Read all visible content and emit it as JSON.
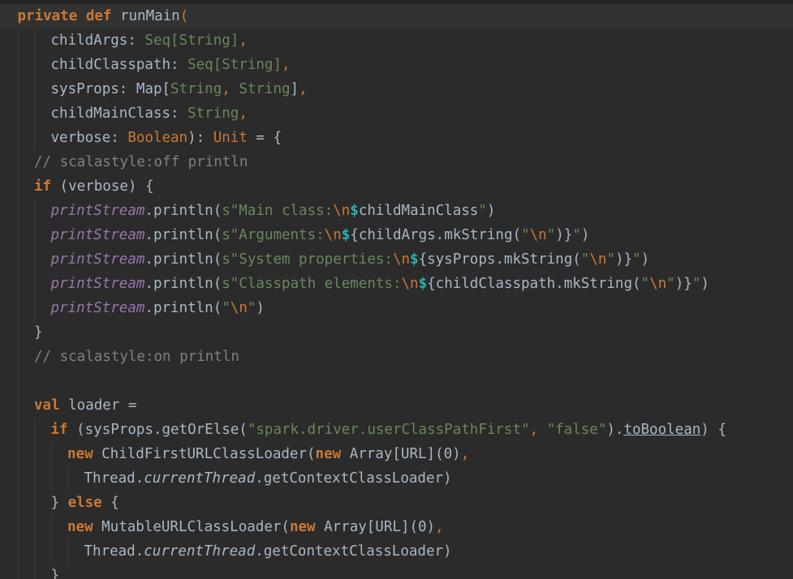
{
  "editor": {
    "colors": {
      "background": "#2b2b2b",
      "caret_row": "#323232",
      "keyword": "#cc7832",
      "string": "#6a8759",
      "comment": "#808080",
      "field": "#9876aa",
      "default": "#a9b7c6",
      "interpolation": "#27b3b3"
    },
    "lines": [
      {
        "indent": 1,
        "guides": [],
        "tokens": [
          {
            "t": "private",
            "c": "kw"
          },
          {
            "t": " ",
            "c": "pl"
          },
          {
            "t": "def",
            "c": "kw"
          },
          {
            "t": " runMain",
            "c": "pl"
          },
          {
            "t": "(",
            "c": "kwn"
          }
        ]
      },
      {
        "indent": 3,
        "guides": [
          1,
          2
        ],
        "tokens": [
          {
            "t": "childArgs",
            "c": "pl"
          },
          {
            "t": ": ",
            "c": "pl"
          },
          {
            "t": "Seq[String]",
            "c": "ty"
          },
          {
            "t": ",",
            "c": "kwn"
          }
        ]
      },
      {
        "indent": 3,
        "guides": [
          1,
          2
        ],
        "tokens": [
          {
            "t": "childClasspath",
            "c": "pl"
          },
          {
            "t": ": ",
            "c": "pl"
          },
          {
            "t": "Seq[String]",
            "c": "ty"
          },
          {
            "t": ",",
            "c": "kwn"
          }
        ]
      },
      {
        "indent": 3,
        "guides": [
          1,
          2
        ],
        "tokens": [
          {
            "t": "sysProps",
            "c": "pl"
          },
          {
            "t": ": ",
            "c": "pl"
          },
          {
            "t": "Map[",
            "c": "pl"
          },
          {
            "t": "String",
            "c": "ty"
          },
          {
            "t": ", ",
            "c": "kwn"
          },
          {
            "t": "String",
            "c": "ty"
          },
          {
            "t": "]",
            "c": "pl"
          },
          {
            "t": ",",
            "c": "kwn"
          }
        ]
      },
      {
        "indent": 3,
        "guides": [
          1,
          2
        ],
        "tokens": [
          {
            "t": "childMainClass",
            "c": "pl"
          },
          {
            "t": ": ",
            "c": "pl"
          },
          {
            "t": "String",
            "c": "ty"
          },
          {
            "t": ",",
            "c": "kwn"
          }
        ]
      },
      {
        "indent": 3,
        "guides": [
          1,
          2
        ],
        "tokens": [
          {
            "t": "verbose",
            "c": "pl"
          },
          {
            "t": ": ",
            "c": "pl"
          },
          {
            "t": "Boolean",
            "c": "kwn"
          },
          {
            "t": "): ",
            "c": "pl"
          },
          {
            "t": "Unit",
            "c": "kwn"
          },
          {
            "t": " = {",
            "c": "pl"
          }
        ]
      },
      {
        "indent": 2,
        "guides": [
          1
        ],
        "tokens": [
          {
            "t": "// scalastyle:off println",
            "c": "cm"
          }
        ]
      },
      {
        "indent": 2,
        "guides": [
          1
        ],
        "tokens": [
          {
            "t": "if",
            "c": "kw"
          },
          {
            "t": " (verbose) {",
            "c": "pl"
          }
        ]
      },
      {
        "indent": 3,
        "guides": [
          1,
          2
        ],
        "tokens": [
          {
            "t": "printStream",
            "c": "fld"
          },
          {
            "t": ".println(",
            "c": "pl"
          },
          {
            "t": "s\"Main class:",
            "c": "str"
          },
          {
            "t": "\\n",
            "c": "esc"
          },
          {
            "t": "$",
            "c": "dol"
          },
          {
            "t": "childMainClass",
            "c": "pl"
          },
          {
            "t": "\"",
            "c": "str"
          },
          {
            "t": ")",
            "c": "pl"
          }
        ]
      },
      {
        "indent": 3,
        "guides": [
          1,
          2
        ],
        "tokens": [
          {
            "t": "printStream",
            "c": "fld"
          },
          {
            "t": ".println(",
            "c": "pl"
          },
          {
            "t": "s\"Arguments:",
            "c": "str"
          },
          {
            "t": "\\n",
            "c": "esc"
          },
          {
            "t": "$",
            "c": "dol"
          },
          {
            "t": "{childArgs.mkString(",
            "c": "pl"
          },
          {
            "t": "\"",
            "c": "str"
          },
          {
            "t": "\\n",
            "c": "esc"
          },
          {
            "t": "\"",
            "c": "str"
          },
          {
            "t": ")}",
            "c": "pl"
          },
          {
            "t": "\"",
            "c": "str"
          },
          {
            "t": ")",
            "c": "pl"
          }
        ]
      },
      {
        "indent": 3,
        "guides": [
          1,
          2
        ],
        "tokens": [
          {
            "t": "printStream",
            "c": "fld"
          },
          {
            "t": ".println(",
            "c": "pl"
          },
          {
            "t": "s\"System properties:",
            "c": "str"
          },
          {
            "t": "\\n",
            "c": "esc"
          },
          {
            "t": "$",
            "c": "dol"
          },
          {
            "t": "{sysProps.mkString(",
            "c": "pl"
          },
          {
            "t": "\"",
            "c": "str"
          },
          {
            "t": "\\n",
            "c": "esc"
          },
          {
            "t": "\"",
            "c": "str"
          },
          {
            "t": ")}",
            "c": "pl"
          },
          {
            "t": "\"",
            "c": "str"
          },
          {
            "t": ")",
            "c": "pl"
          }
        ]
      },
      {
        "indent": 3,
        "guides": [
          1,
          2
        ],
        "tokens": [
          {
            "t": "printStream",
            "c": "fld"
          },
          {
            "t": ".println(",
            "c": "pl"
          },
          {
            "t": "s\"Classpath elements:",
            "c": "str"
          },
          {
            "t": "\\n",
            "c": "esc"
          },
          {
            "t": "$",
            "c": "dol"
          },
          {
            "t": "{childClasspath.mkString(",
            "c": "pl"
          },
          {
            "t": "\"",
            "c": "str"
          },
          {
            "t": "\\n",
            "c": "esc"
          },
          {
            "t": "\"",
            "c": "str"
          },
          {
            "t": ")}",
            "c": "pl"
          },
          {
            "t": "\"",
            "c": "str"
          },
          {
            "t": ")",
            "c": "pl"
          }
        ]
      },
      {
        "indent": 3,
        "guides": [
          1,
          2
        ],
        "tokens": [
          {
            "t": "printStream",
            "c": "fld"
          },
          {
            "t": ".println(",
            "c": "pl"
          },
          {
            "t": "\"",
            "c": "str"
          },
          {
            "t": "\\n",
            "c": "esc"
          },
          {
            "t": "\"",
            "c": "str"
          },
          {
            "t": ")",
            "c": "pl"
          }
        ]
      },
      {
        "indent": 2,
        "guides": [
          1
        ],
        "tokens": [
          {
            "t": "}",
            "c": "pl"
          }
        ]
      },
      {
        "indent": 2,
        "guides": [
          1
        ],
        "tokens": [
          {
            "t": "// scalastyle:on println",
            "c": "cm"
          }
        ]
      },
      {
        "indent": 2,
        "guides": [
          1
        ],
        "tokens": []
      },
      {
        "indent": 2,
        "guides": [
          1
        ],
        "tokens": [
          {
            "t": "val",
            "c": "kw"
          },
          {
            "t": " loader =",
            "c": "pl"
          }
        ]
      },
      {
        "indent": 3,
        "guides": [
          1,
          2
        ],
        "tokens": [
          {
            "t": "if",
            "c": "kw"
          },
          {
            "t": " (sysProps.getOrElse(",
            "c": "pl"
          },
          {
            "t": "\"spark.driver.userClassPathFirst\"",
            "c": "str"
          },
          {
            "t": ", ",
            "c": "kwn"
          },
          {
            "t": "\"false\"",
            "c": "str"
          },
          {
            "t": ").",
            "c": "pl"
          },
          {
            "t": "toBoolean",
            "c": "ul"
          },
          {
            "t": ") {",
            "c": "pl"
          }
        ]
      },
      {
        "indent": 4,
        "guides": [
          1,
          2,
          3
        ],
        "tokens": [
          {
            "t": "new",
            "c": "kw"
          },
          {
            "t": " ChildFirstURLClassLoader(",
            "c": "pl"
          },
          {
            "t": "new",
            "c": "kw"
          },
          {
            "t": " Array[URL](",
            "c": "pl"
          },
          {
            "t": "0",
            "c": "pl"
          },
          {
            "t": ")",
            "c": "pl"
          },
          {
            "t": ",",
            "c": "kwn"
          }
        ]
      },
      {
        "indent": 5,
        "guides": [
          1,
          2,
          3,
          4
        ],
        "tokens": [
          {
            "t": "Thread.",
            "c": "pl"
          },
          {
            "t": "currentThread",
            "c": "ital"
          },
          {
            "t": ".getContextClassLoader)",
            "c": "pl"
          }
        ]
      },
      {
        "indent": 3,
        "guides": [
          1,
          2
        ],
        "tokens": [
          {
            "t": "} ",
            "c": "pl"
          },
          {
            "t": "else",
            "c": "kw"
          },
          {
            "t": " {",
            "c": "pl"
          }
        ]
      },
      {
        "indent": 4,
        "guides": [
          1,
          2,
          3
        ],
        "tokens": [
          {
            "t": "new",
            "c": "kw"
          },
          {
            "t": " MutableURLClassLoader(",
            "c": "pl"
          },
          {
            "t": "new",
            "c": "kw"
          },
          {
            "t": " Array[URL](",
            "c": "pl"
          },
          {
            "t": "0",
            "c": "pl"
          },
          {
            "t": ")",
            "c": "pl"
          },
          {
            "t": ",",
            "c": "kwn"
          }
        ]
      },
      {
        "indent": 5,
        "guides": [
          1,
          2,
          3,
          4
        ],
        "tokens": [
          {
            "t": "Thread.",
            "c": "pl"
          },
          {
            "t": "currentThread",
            "c": "ital"
          },
          {
            "t": ".getContextClassLoader)",
            "c": "pl"
          }
        ]
      },
      {
        "indent": 3,
        "guides": [
          1,
          2
        ],
        "tokens": [
          {
            "t": "}",
            "c": "pl"
          }
        ]
      }
    ]
  }
}
